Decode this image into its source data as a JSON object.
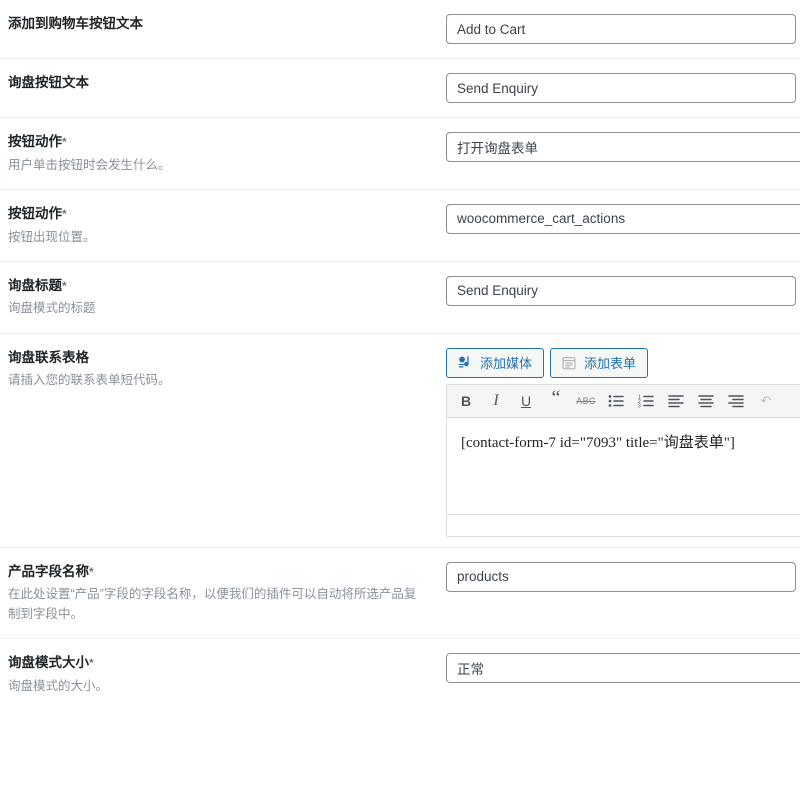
{
  "colors": {
    "accent": "#2271b1",
    "label_text": "#1d2327",
    "desc_text": "#8a9199",
    "divider": "#eceeef",
    "input_border": "#8c8f94",
    "editor_border": "#dcdcde",
    "toolbar_bg": "#f5f5f5"
  },
  "form": {
    "rows": [
      {
        "id": "add-to-cart-button-text",
        "label": "添加到购物车按钮文本",
        "required": false,
        "description": "",
        "control": {
          "type": "text",
          "value": "Add to Cart"
        }
      },
      {
        "id": "enquiry-button-text",
        "label": "询盘按钮文本",
        "required": false,
        "description": "",
        "control": {
          "type": "text",
          "value": "Send Enquiry"
        }
      },
      {
        "id": "button-action",
        "label": "按钮动作",
        "required": true,
        "description": "用户单击按钮时会发生什么。",
        "control": {
          "type": "select",
          "value": "打开询盘表单"
        }
      },
      {
        "id": "button-position",
        "label": "按钮动作",
        "required": true,
        "description": "按钮出现位置。",
        "control": {
          "type": "select",
          "value": "woocommerce_cart_actions"
        }
      },
      {
        "id": "enquiry-title",
        "label": "询盘标题",
        "required": true,
        "description": "询盘模式的标题",
        "control": {
          "type": "text",
          "value": "Send Enquiry"
        }
      },
      {
        "id": "enquiry-contact-form",
        "label": "询盘联系表格",
        "required": false,
        "description": "请插入您的联系表单短代码。",
        "control": {
          "type": "editor"
        }
      },
      {
        "id": "product-field-name",
        "label": "产品字段名称",
        "required": true,
        "description": "在此处设置“产品”字段的字段名称，以便我们的插件可以自动将所选产品复制到字段中。",
        "control": {
          "type": "text",
          "value": "products"
        }
      },
      {
        "id": "enquiry-modal-size",
        "label": "询盘模式大小",
        "required": true,
        "description": "询盘模式的大小。",
        "control": {
          "type": "select",
          "value": "正常"
        }
      }
    ]
  },
  "editor": {
    "add_media_label": "添加媒体",
    "add_media_icon": "media-icon",
    "add_form_label": "添加表单",
    "add_form_icon": "form-icon",
    "content": "[contact-form-7 id=\"7093\" title=\"询盘表单\"]",
    "toolbar": [
      {
        "name": "bold-button",
        "glyph": "B",
        "style": "bold"
      },
      {
        "name": "italic-button",
        "glyph": "I",
        "style": "italic"
      },
      {
        "name": "underline-button",
        "glyph": "U",
        "style": "under"
      },
      {
        "name": "blockquote-button",
        "glyph": "“",
        "style": "quote"
      },
      {
        "name": "strikethrough-button",
        "glyph": "ABC",
        "style": "strike"
      },
      {
        "name": "bulleted-list-button",
        "glyph": "",
        "style": "svg-ul"
      },
      {
        "name": "numbered-list-button",
        "glyph": "",
        "style": "svg-ol"
      },
      {
        "name": "align-left-button",
        "glyph": "",
        "style": "svg-al"
      },
      {
        "name": "align-center-button",
        "glyph": "",
        "style": "svg-ac"
      },
      {
        "name": "align-right-button",
        "glyph": "",
        "style": "svg-ar"
      },
      {
        "name": "undo-button",
        "glyph": "↶",
        "style": "undo"
      }
    ]
  }
}
